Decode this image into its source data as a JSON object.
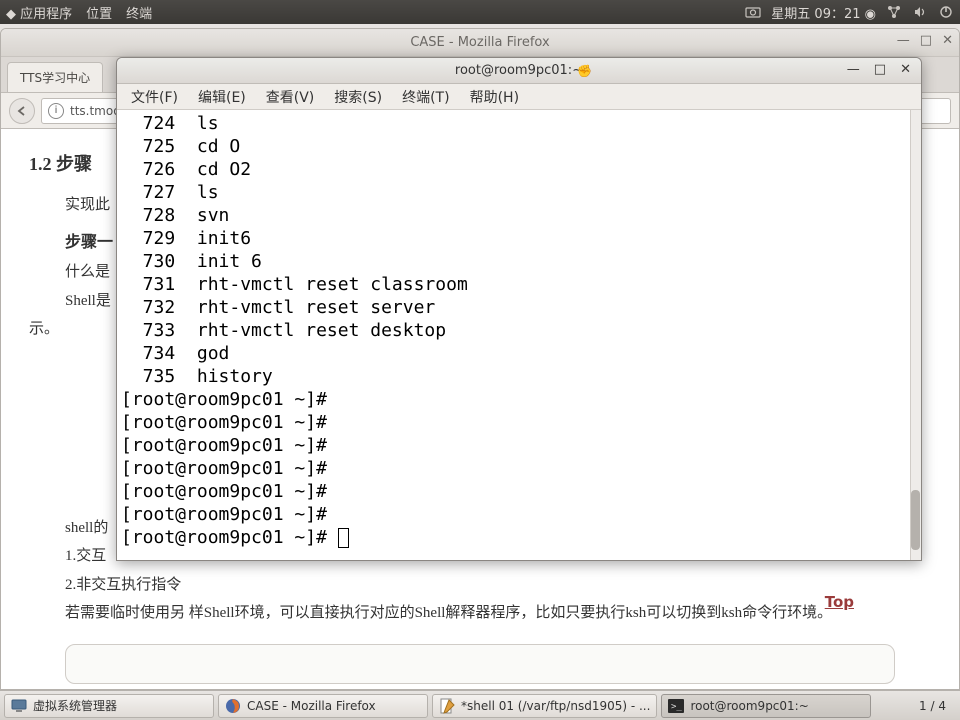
{
  "top_panel": {
    "applications": "应用程序",
    "places": "位置",
    "terminal": "终端",
    "datetime": "星期五 09：21"
  },
  "firefox": {
    "title": "CASE - Mozilla Firefox",
    "tab": "TTS学习中心",
    "url": "tts.tmoo",
    "content": {
      "h1": "1.2 步骤",
      "p1": "实现此",
      "h2": "步骤一",
      "p2": "什么是",
      "p3": "Shell是",
      "p4": "示。",
      "p5": "shell的",
      "p6": "1.交互",
      "p7": "2.非交互执行指令",
      "p8": "若需要临时使用另        样Shell环境，可以直接执行对应的Shell解释器程序，比如只要执行ksh可以切换到ksh命令行环境。",
      "top_link": "Top"
    }
  },
  "terminal": {
    "title": "root@room9pc01:",
    "menu": {
      "file": "文件(F)",
      "edit": "编辑(E)",
      "view": "查看(V)",
      "search": "搜索(S)",
      "terminal": "终端(T)",
      "help": "帮助(H)"
    },
    "history": [
      {
        "n": "724",
        "cmd": "ls"
      },
      {
        "n": "725",
        "cmd": "cd O"
      },
      {
        "n": "726",
        "cmd": "cd O2"
      },
      {
        "n": "727",
        "cmd": "ls"
      },
      {
        "n": "728",
        "cmd": "svn"
      },
      {
        "n": "729",
        "cmd": "init6"
      },
      {
        "n": "730",
        "cmd": "init 6"
      },
      {
        "n": "731",
        "cmd": "rht-vmctl reset classroom"
      },
      {
        "n": "732",
        "cmd": "rht-vmctl reset server"
      },
      {
        "n": "733",
        "cmd": "rht-vmctl reset desktop"
      },
      {
        "n": "734",
        "cmd": "god"
      },
      {
        "n": "735",
        "cmd": "history"
      }
    ],
    "prompt": "[root@room9pc01 ~]#",
    "prompt_repeat": 7
  },
  "taskbar": {
    "items": [
      {
        "label": "虚拟系统管理器",
        "icon": "monitor"
      },
      {
        "label": "CASE - Mozilla Firefox",
        "icon": "firefox"
      },
      {
        "label": "*shell 01 (/var/ftp/nsd1905) - ...",
        "icon": "editor"
      },
      {
        "label": "root@room9pc01:~",
        "icon": "terminal",
        "active": true
      }
    ],
    "pager": "1  /  4"
  }
}
